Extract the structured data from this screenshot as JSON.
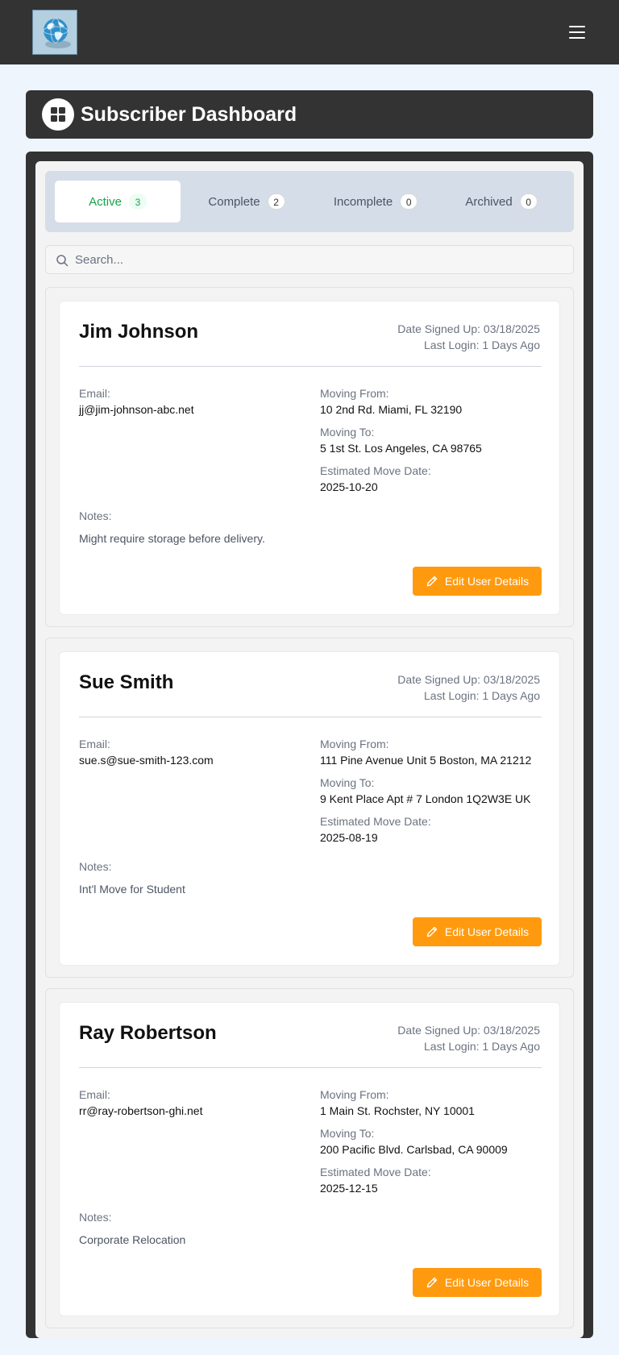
{
  "header": {
    "title": "Subscriber Dashboard"
  },
  "tabs": [
    {
      "label": "Active",
      "count": "3",
      "active": true
    },
    {
      "label": "Complete",
      "count": "2",
      "active": false
    },
    {
      "label": "Incomplete",
      "count": "0",
      "active": false
    },
    {
      "label": "Archived",
      "count": "0",
      "active": false
    }
  ],
  "search": {
    "placeholder": "Search..."
  },
  "labels": {
    "email": "Email:",
    "moving_from": "Moving From:",
    "moving_to": "Moving To:",
    "move_date": "Estimated Move Date:",
    "notes": "Notes:",
    "edit_button": "Edit User Details"
  },
  "subscribers": [
    {
      "name": "Jim Johnson",
      "signed_up": "Date Signed Up: 03/18/2025",
      "last_login": "Last Login: 1 Days Ago",
      "email": "jj@jim-johnson-abc.net",
      "moving_from": "10 2nd Rd. Miami, FL 32190",
      "moving_to": "5 1st St. Los Angeles, CA 98765",
      "move_date": "2025-10-20",
      "notes": "Might require storage before delivery."
    },
    {
      "name": "Sue Smith",
      "signed_up": "Date Signed Up: 03/18/2025",
      "last_login": "Last Login: 1 Days Ago",
      "email": "sue.s@sue-smith-123.com",
      "moving_from": "111 Pine Avenue Unit 5 Boston, MA 21212",
      "moving_to": "9 Kent Place Apt # 7 London 1Q2W3E UK",
      "move_date": "2025-08-19",
      "notes": "Int'l Move for Student"
    },
    {
      "name": "Ray Robertson",
      "signed_up": "Date Signed Up: 03/18/2025",
      "last_login": "Last Login: 1 Days Ago",
      "email": "rr@ray-robertson-ghi.net",
      "moving_from": "1 Main St. Rochster, NY 10001",
      "moving_to": "200 Pacific Blvd. Carlsbad, CA 90009",
      "move_date": "2025-12-15",
      "notes": "Corporate Relocation"
    }
  ],
  "colors": {
    "topbar": "#333333",
    "accent_active": "#16a34a",
    "edit_button": "#ff9a0f",
    "background": "#eef5fd"
  },
  "icons": {
    "logo": "globe-logo",
    "menu": "hamburger-menu-icon",
    "dashboard": "dashboard-grid-icon",
    "search": "search-icon",
    "edit": "pencil-icon"
  }
}
